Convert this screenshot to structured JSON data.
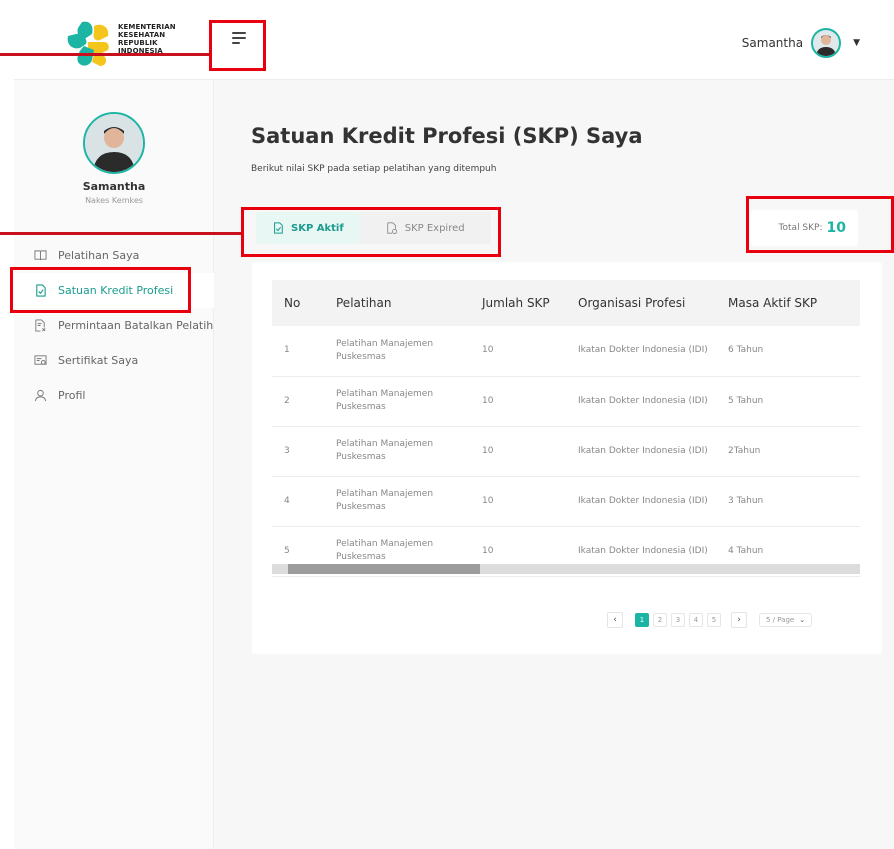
{
  "header": {
    "logo_lines": [
      "KEMENTERIAN",
      "KESEHATAN",
      "REPUBLIK",
      "INDONESIA"
    ],
    "user_name": "Samantha"
  },
  "sidebar": {
    "profile": {
      "name": "Samantha",
      "role": "Nakes Kemkes"
    },
    "items": [
      {
        "label": "Pelatihan Saya",
        "icon": "book-icon"
      },
      {
        "label": "Satuan Kredit Profesi",
        "icon": "document-check-icon",
        "active": true
      },
      {
        "label": "Permintaan Batalkan Pelatihan",
        "icon": "document-cancel-icon"
      },
      {
        "label": "Sertifikat Saya",
        "icon": "certificate-icon"
      },
      {
        "label": "Profil",
        "icon": "user-icon"
      }
    ]
  },
  "main": {
    "title": "Satuan Kredit Profesi (SKP) Saya",
    "subtitle": "Berikut nilai SKP pada setiap pelatihan yang ditempuh",
    "tabs": [
      {
        "label": "SKP Aktif",
        "active": true
      },
      {
        "label": "SKP Expired",
        "active": false
      }
    ],
    "total": {
      "label": "Total SKP:",
      "value": "10"
    },
    "table": {
      "headers": [
        "No",
        "Pelatihan",
        "Jumlah SKP",
        "Organisasi Profesi",
        "Masa Aktif SKP"
      ],
      "rows": [
        {
          "no": "1",
          "pelatihan": "Pelatihan Manajemen Puskesmas",
          "jumlah": "10",
          "organisasi": "Ikatan Dokter Indonesia (IDI)",
          "masa": "6 Tahun"
        },
        {
          "no": "2",
          "pelatihan": "Pelatihan Manajemen Puskesmas",
          "jumlah": "10",
          "organisasi": "Ikatan Dokter Indonesia (IDI)",
          "masa": "5 Tahun"
        },
        {
          "no": "3",
          "pelatihan": "Pelatihan Manajemen Puskesmas",
          "jumlah": "10",
          "organisasi": "Ikatan Dokter Indonesia (IDI)",
          "masa": "2Tahun"
        },
        {
          "no": "4",
          "pelatihan": "Pelatihan Manajemen Puskesmas",
          "jumlah": "10",
          "organisasi": "Ikatan Dokter Indonesia (IDI)",
          "masa": "3 Tahun"
        },
        {
          "no": "5",
          "pelatihan": "Pelatihan Manajemen Puskesmas",
          "jumlah": "10",
          "organisasi": "Ikatan Dokter Indonesia (IDI)",
          "masa": "4 Tahun"
        }
      ]
    },
    "pagination": {
      "prev": "‹",
      "next": "›",
      "pages": [
        "1",
        "2",
        "3",
        "4",
        "5"
      ],
      "current": "1",
      "per_page": "5 / Page"
    }
  },
  "colors": {
    "accent": "#1cb5a3",
    "accent_text": "#1a9c8e",
    "annotation": "#e8000e"
  }
}
